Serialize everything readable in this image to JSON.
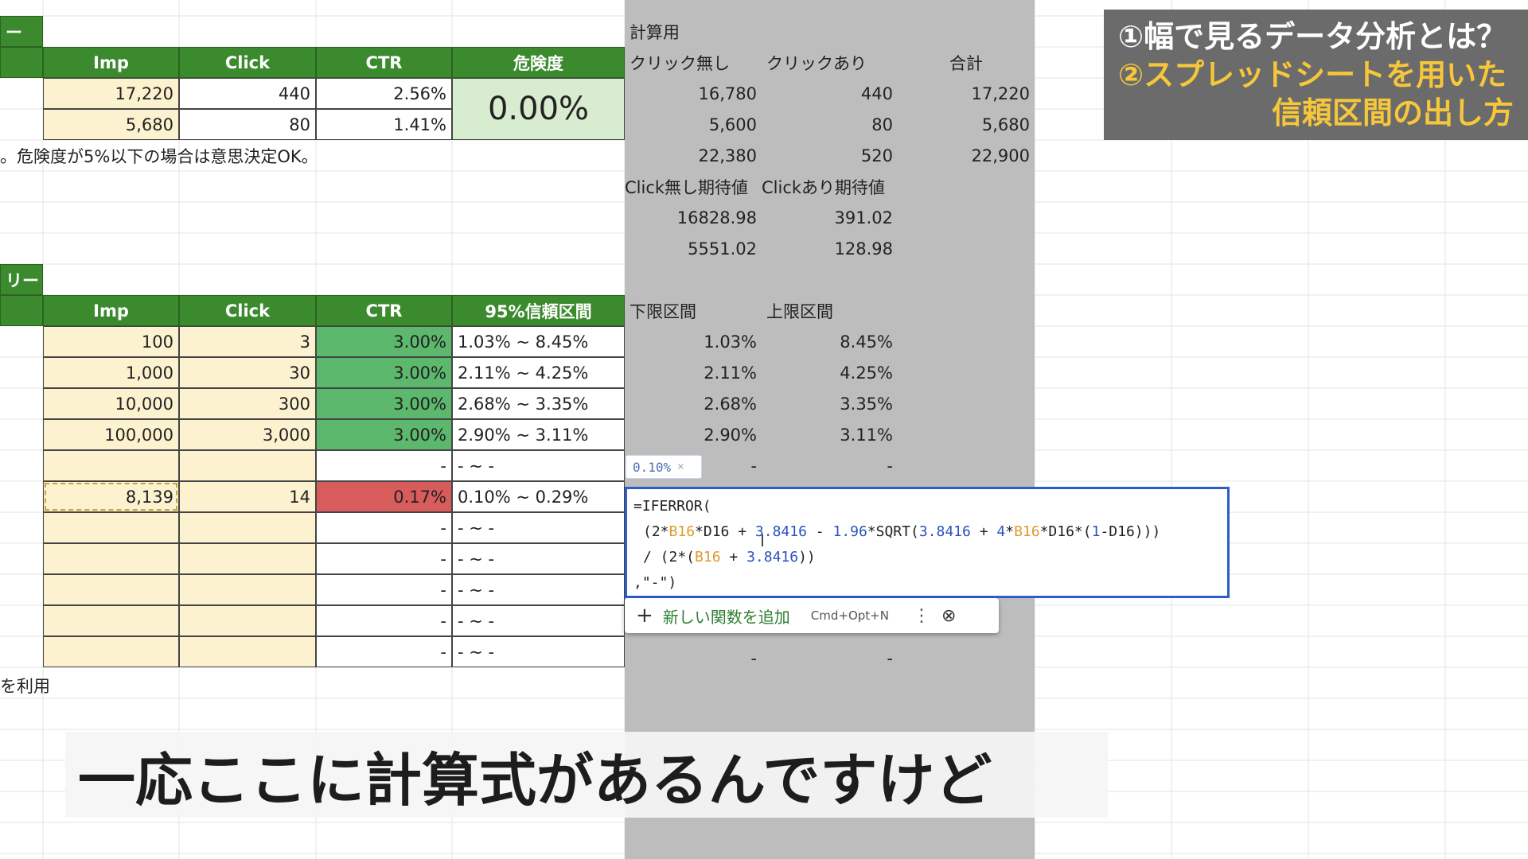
{
  "top_table": {
    "section_tab_label": "ー",
    "headers": [
      "Imp",
      "Click",
      "CTR",
      "危険度"
    ],
    "rows": [
      {
        "imp": "17,220",
        "click": "440",
        "ctr": "2.56%"
      },
      {
        "imp": "5,680",
        "click": "80",
        "ctr": "1.41%"
      }
    ],
    "risk_value": "0.00%",
    "note": "。危険度が5%以下の場合は意思決定OK。"
  },
  "calc": {
    "section_label": "計算用",
    "headers": [
      "クリック無し",
      "クリックあり",
      "合計"
    ],
    "rows": [
      [
        "16,780",
        "440",
        "17,220"
      ],
      [
        "5,600",
        "80",
        "5,680"
      ],
      [
        "22,380",
        "520",
        "22,900"
      ]
    ],
    "expected_headers": [
      "Click無し期待値",
      "Clickあり期待値"
    ],
    "expected_rows": [
      [
        "16828.98",
        "391.02"
      ],
      [
        "5551.02",
        "128.98"
      ]
    ],
    "interval_headers": [
      "下限区間",
      "上限区間"
    ],
    "interval_rows": [
      [
        "1.03%",
        "8.45%"
      ],
      [
        "2.11%",
        "4.25%"
      ],
      [
        "2.68%",
        "3.35%"
      ],
      [
        "2.90%",
        "3.11%"
      ],
      [
        "-",
        "-"
      ]
    ],
    "bottom_row": [
      "-",
      "-"
    ]
  },
  "ci_table": {
    "section_tab_label": "リー",
    "headers": [
      "Imp",
      "Click",
      "CTR",
      "95%信頼区間"
    ],
    "rows": [
      {
        "imp": "100",
        "click": "3",
        "ctr": "3.00%",
        "ci": "1.03% ~ 8.45%"
      },
      {
        "imp": "1,000",
        "click": "30",
        "ctr": "3.00%",
        "ci": "2.11% ~ 4.25%"
      },
      {
        "imp": "10,000",
        "click": "300",
        "ctr": "3.00%",
        "ci": "2.68% ~ 3.35%"
      },
      {
        "imp": "100,000",
        "click": "3,000",
        "ctr": "3.00%",
        "ci": "2.90% ~ 3.11%"
      },
      {
        "imp": "",
        "click": "",
        "ctr": "-",
        "ci": "- ~ -"
      },
      {
        "imp": "8,139",
        "click": "14",
        "ctr": "0.17%",
        "ci": "0.10% ~ 0.29%"
      },
      {
        "imp": "",
        "click": "",
        "ctr": "-",
        "ci": "- ~ -"
      },
      {
        "imp": "",
        "click": "",
        "ctr": "-",
        "ci": "- ~ -"
      },
      {
        "imp": "",
        "click": "",
        "ctr": "-",
        "ci": "- ~ -"
      },
      {
        "imp": "",
        "click": "",
        "ctr": "-",
        "ci": "- ~ -"
      },
      {
        "imp": "",
        "click": "",
        "ctr": "-",
        "ci": "- ~ -"
      }
    ],
    "footer_note": "を利用"
  },
  "tooltip": {
    "value": "0.10%",
    "close": "×"
  },
  "formula": {
    "line1": "=IFERROR(",
    "line2_parts": [
      "(2*",
      "B16",
      "*D16 + ",
      "3.8416",
      " - ",
      "1.96",
      "*SQRT(",
      "3.8416",
      " + ",
      "4",
      "*",
      "B16",
      "*D16*(",
      "1",
      "-D16)))"
    ],
    "line3_parts": [
      "/ (2*(",
      "B16",
      " + ",
      "3.8416",
      "))"
    ],
    "line4": ",\"-\")"
  },
  "function_menu": {
    "add_label": "新しい関数を追加",
    "shortcut": "Cmd+Opt+N",
    "plus_icon": "+",
    "dots_icon": "⋮",
    "close_icon": "⊗"
  },
  "title_overlay": {
    "line1": "①幅で見るデータ分析とは？",
    "line2": "②スプレッドシートを用いた",
    "line3": "信頼区間の出し方"
  },
  "subtitle": "一応ここに計算式があるんですけど",
  "colors": {
    "header_green": "#3c8a2e",
    "input_yellow": "#fdf2cf",
    "ctr_green": "#5bb86c",
    "ctr_red": "#d85c5c",
    "calc_gray": "#bdbdbd",
    "title_yellow": "#f6c73a",
    "formula_border": "#2b5ec9"
  }
}
